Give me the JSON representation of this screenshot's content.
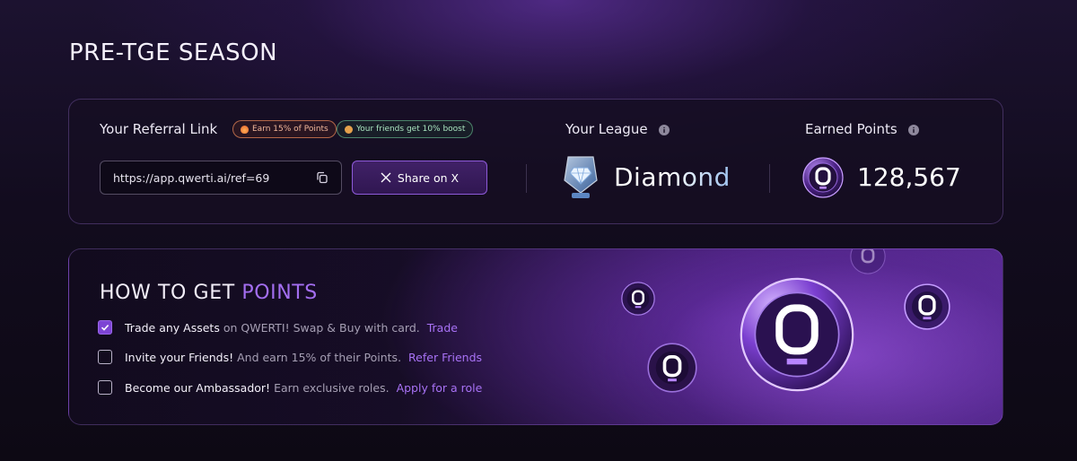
{
  "page": {
    "title": "PRE-TGE SEASON"
  },
  "referral": {
    "label": "Your Referral Link",
    "badge_points": "Earn 15% of Points",
    "badge_boost": "Your friends get 10% boost",
    "link": "https://app.qwerti.ai/ref=69",
    "share_label": "Share on X"
  },
  "league": {
    "label": "Your League",
    "value": "Diamond"
  },
  "points": {
    "label": "Earned Points",
    "value": "128,567"
  },
  "how": {
    "title_main": "HOW TO GET ",
    "title_accent": "POINTS",
    "tasks": [
      {
        "strong": "Trade any Assets",
        "muted": "on QWERTI! Swap & Buy with card.",
        "link": "Trade",
        "checked": true
      },
      {
        "strong": "Invite your Friends!",
        "muted": "And earn 15% of their Points.",
        "link": "Refer Friends",
        "checked": false
      },
      {
        "strong": "Become our Ambassador!",
        "muted": "Earn exclusive roles.",
        "link": "Apply for a role",
        "checked": false
      }
    ]
  },
  "colors": {
    "accent": "#a872f5",
    "check_fill": "#7d44d4",
    "card_border": "#5a4478"
  },
  "icons": [
    "copy-icon",
    "x-logo-icon",
    "info-icon",
    "diamond-league-badge-icon",
    "qwerti-coin-icon",
    "checkmark-icon"
  ]
}
